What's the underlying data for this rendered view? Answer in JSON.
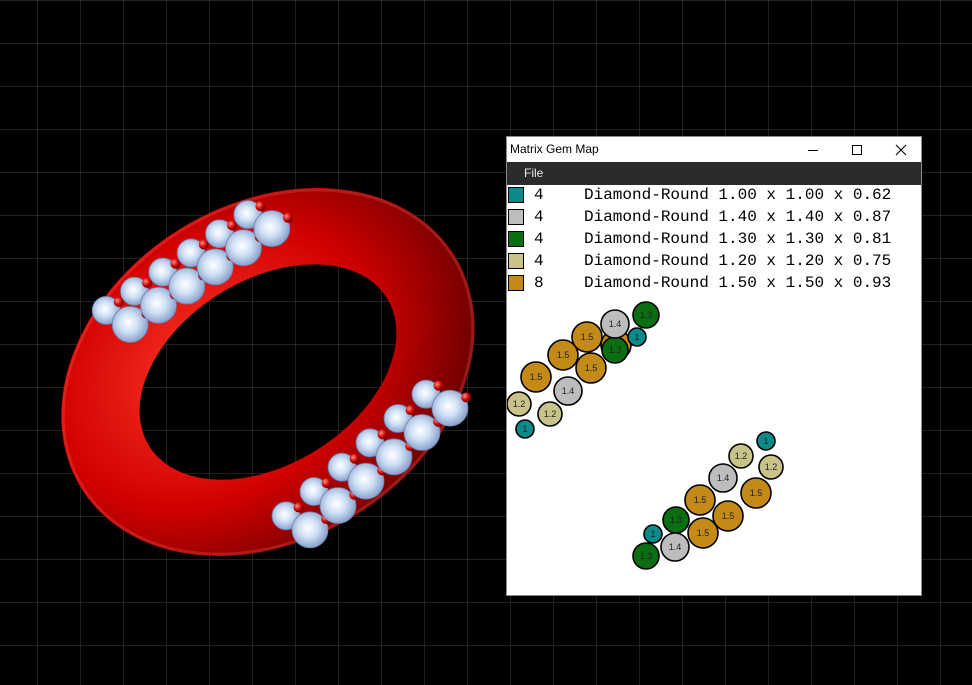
{
  "window": {
    "title": "Matrix Gem Map",
    "menu": [
      {
        "label": "File"
      }
    ]
  },
  "legend": [
    {
      "color": "#0b8a8a",
      "count": "4",
      "description": "Diamond-Round 1.00 x 1.00 x 0.62"
    },
    {
      "color": "#bdbdbd",
      "count": "4",
      "description": "Diamond-Round 1.40 x 1.40 x 0.87"
    },
    {
      "color": "#0b6e12",
      "count": "4",
      "description": "Diamond-Round 1.30 x 1.30 x 0.81"
    },
    {
      "color": "#c9c38a",
      "count": "4",
      "description": "Diamond-Round 1.20 x 1.20 x 0.75"
    },
    {
      "color": "#c48a18",
      "count": "8",
      "description": "Diamond-Round 1.50 x 1.50 x 0.93"
    }
  ],
  "gem_labels": {
    "teal": "1",
    "gray": "1.4",
    "green": "1.3",
    "tan": "1.2",
    "gold": "1.5"
  },
  "colors": {
    "teal": "#0b8a8a",
    "gray": "#bdbdbd",
    "green": "#0b6e12",
    "tan": "#c9c38a",
    "gold": "#c48a18",
    "ring": "#d40000"
  }
}
